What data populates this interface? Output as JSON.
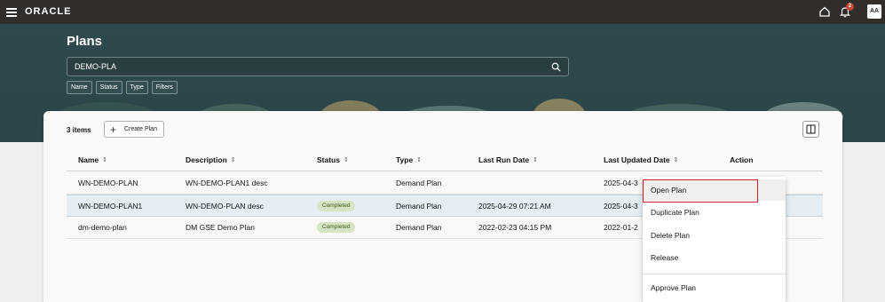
{
  "topbar": {
    "logo": "ORACLE",
    "notification_count": "2",
    "avatar": "AA"
  },
  "header": {
    "title": "Plans"
  },
  "search": {
    "value": "DEMO-PLA"
  },
  "filters": [
    "Name",
    "Status",
    "Type",
    "Filters"
  ],
  "toolbar": {
    "items_count": "3 items",
    "create_label": "Create Plan"
  },
  "table": {
    "columns": [
      "Name",
      "Description",
      "Status",
      "Type",
      "Last Run Date",
      "Last Updated Date",
      "Action"
    ],
    "rows": [
      {
        "name": "WN-DEMO-PLAN",
        "description": "WN-DEMO-PLAN1 desc",
        "status": "",
        "type": "Demand Plan",
        "last_run": "",
        "last_updated": "2025-04-3"
      },
      {
        "name": "WN-DEMO-PLAN1",
        "description": "WN-DEMO-PLAN desc",
        "status": "Completed",
        "type": "Demand Plan",
        "last_run": "2025-04-29 07:21 AM",
        "last_updated": "2025-04-3"
      },
      {
        "name": "dm-demo-plan",
        "description": "DM GSE Demo Plan",
        "status": "Completed",
        "type": "Demand Plan",
        "last_run": "2022-02-23 04:15 PM",
        "last_updated": "2022-01-2"
      }
    ]
  },
  "action_menu": {
    "items": [
      "Open Plan",
      "Duplicate Plan",
      "Delete Plan",
      "Release",
      "Approve Plan"
    ]
  },
  "colors": {
    "topbar": "#312d2a",
    "header": "#2f4a4e",
    "selected_row": "#e4eef4",
    "badge_bg": "#d7e4c3",
    "highlight": "#d0212d"
  }
}
